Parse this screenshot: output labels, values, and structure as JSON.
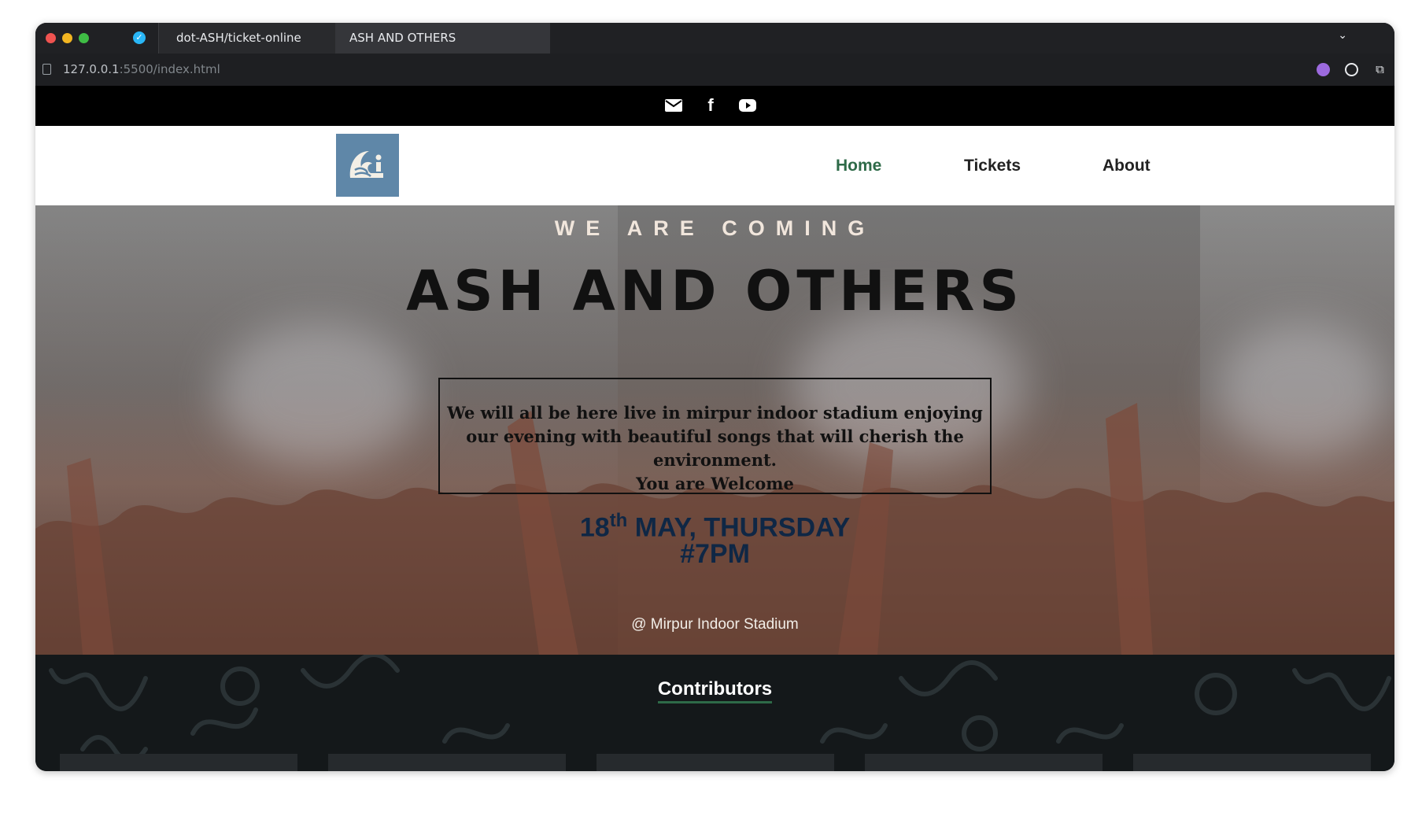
{
  "browser": {
    "tabs": [
      {
        "label": "dot-ASH/ticket-online",
        "active": false
      },
      {
        "label": "ASH AND OTHERS",
        "active": true
      }
    ],
    "url_host": "127.0.0.1",
    "url_path": ":5500/index.html"
  },
  "topbar": {
    "icons": [
      "envelope-icon",
      "facebook-icon",
      "youtube-icon"
    ]
  },
  "nav": {
    "links": [
      "Home",
      "Tickets",
      "About"
    ],
    "active": "Home",
    "active_color": "#2e6a48"
  },
  "hero": {
    "eyebrow": "WE ARE COMING",
    "headline": "ASH AND OTHERS",
    "message_lines": [
      "We will all be here live in mirpur indoor stadium enjoying",
      "our evening with beautiful songs that will cherish the",
      "environment.",
      "You are Welcome"
    ],
    "date_day": "18",
    "date_suffix": "th",
    "date_rest": "MAY, THURSDAY",
    "time": "#7PM",
    "venue": "@ Mirpur Indoor Stadium"
  },
  "contributors": {
    "title": "Contributors"
  }
}
